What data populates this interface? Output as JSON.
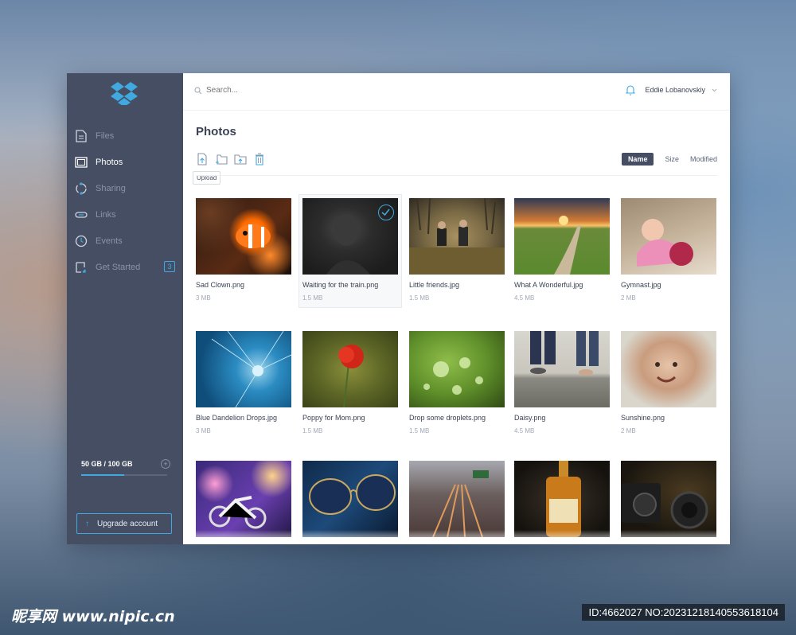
{
  "app": {
    "brand_color": "#3fa9e0",
    "sidebar_bg": "#454e63"
  },
  "sidebar": {
    "items": [
      {
        "label": "Files",
        "icon": "file-icon",
        "active": false
      },
      {
        "label": "Photos",
        "icon": "photo-icon",
        "active": true
      },
      {
        "label": "Sharing",
        "icon": "sharing-icon",
        "active": false
      },
      {
        "label": "Links",
        "icon": "link-icon",
        "active": false
      },
      {
        "label": "Events",
        "icon": "clock-icon",
        "active": false
      },
      {
        "label": "Get Started",
        "icon": "get-started-icon",
        "active": false,
        "badge": "3"
      }
    ],
    "storage_text": "50 GB / 100 GB",
    "storage_fraction": 0.5,
    "upgrade_label": "Upgrade account"
  },
  "topbar": {
    "search_placeholder": "Search...",
    "user_name": "Eddie Lobanovskiy"
  },
  "main": {
    "title": "Photos",
    "tooltip": "Upload",
    "sort": [
      "Name",
      "Size",
      "Modified"
    ],
    "sort_active": "Name"
  },
  "photos": [
    {
      "name": "Sad Clown.png",
      "size": "3 MB"
    },
    {
      "name": "Waiting for the train.png",
      "size": "1.5 MB",
      "selected": true
    },
    {
      "name": "Little friends.jpg",
      "size": "1.5 MB"
    },
    {
      "name": "What A Wonderful.jpg",
      "size": "4.5 MB"
    },
    {
      "name": "Gymnast.jpg",
      "size": "2 MB"
    },
    {
      "name": "Blue Dandelion Drops.jpg",
      "size": "3 MB"
    },
    {
      "name": "Poppy for Mom.png",
      "size": "1.5 MB"
    },
    {
      "name": "Drop some droplets.png",
      "size": "1.5 MB"
    },
    {
      "name": "Daisy.png",
      "size": "4.5 MB"
    },
    {
      "name": "Sunshine.png",
      "size": "2 MB"
    },
    {
      "name": "",
      "size": ""
    },
    {
      "name": "",
      "size": ""
    },
    {
      "name": "",
      "size": ""
    },
    {
      "name": "",
      "size": ""
    },
    {
      "name": "",
      "size": ""
    }
  ],
  "watermark": {
    "left": "昵享网 www.nipic.cn",
    "right": "ID:4662027 NO:20231218140553618104"
  }
}
